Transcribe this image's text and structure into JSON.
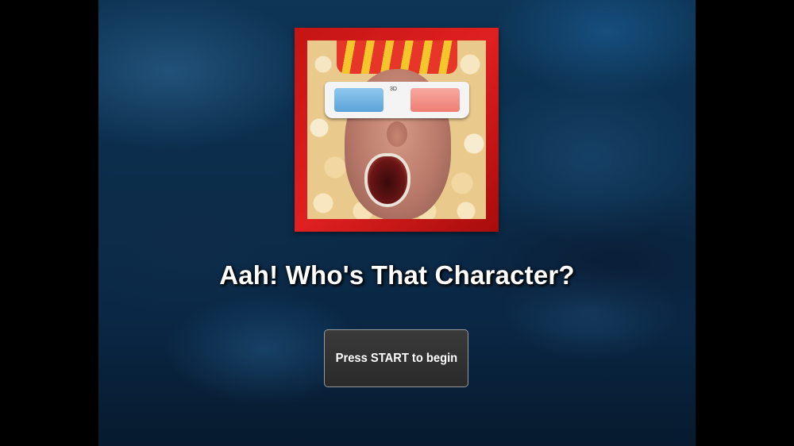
{
  "game": {
    "title": "Aah! Who's That Character?",
    "start_prompt": "Press START to begin",
    "art_badge": "3D"
  },
  "colors": {
    "frame_red": "#c41414",
    "background_blue": "#0b2c49",
    "button_bg": "#2e2e2e",
    "title_text": "#ffffff"
  },
  "icons": {
    "title_art": "popcorn-face-3d-glasses"
  }
}
